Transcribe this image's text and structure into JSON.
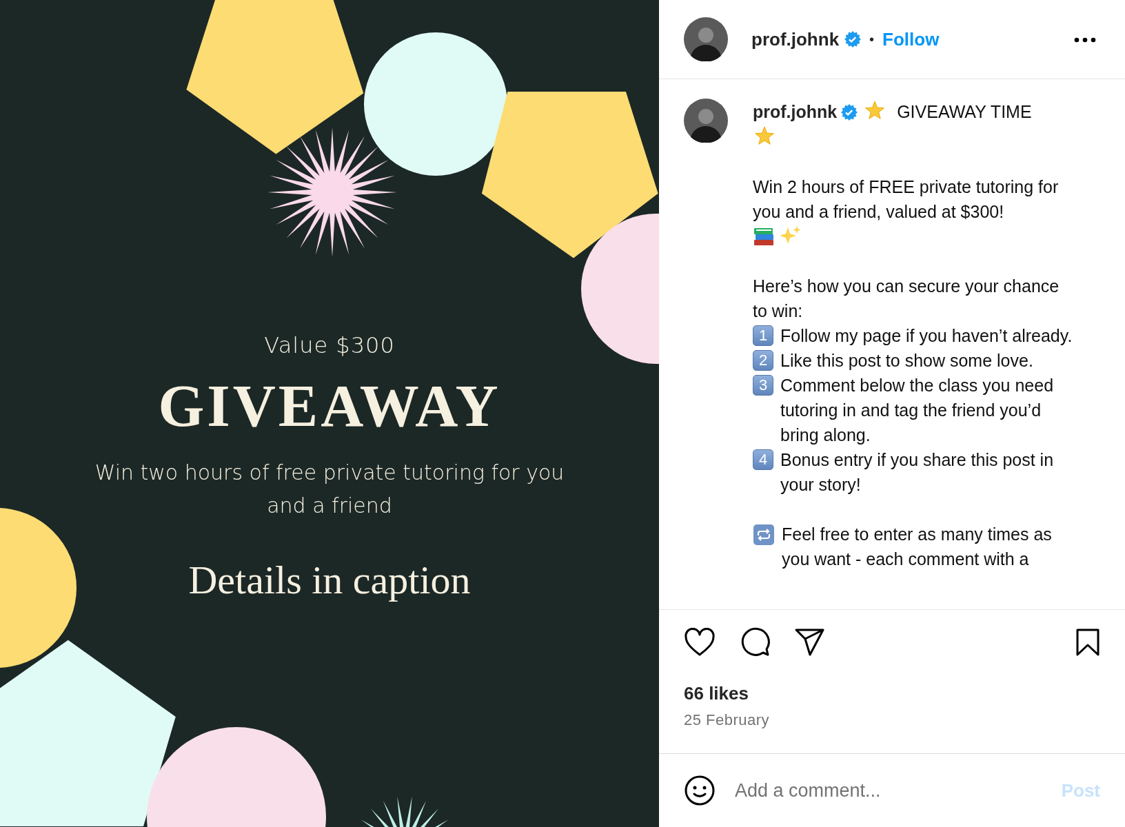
{
  "post_image": {
    "value": "Value $300",
    "title": "GIVEAWAY",
    "subtitle": "Win two hours of free private tutoring for you and a friend",
    "note": "Details in caption"
  },
  "header": {
    "username": "prof.johnk",
    "verified": true,
    "separator": "•",
    "follow": "Follow"
  },
  "caption": {
    "username": "prof.johnk",
    "verified": true,
    "title": "GIVEAWAY TIME",
    "sections": [
      [
        {
          "kind": "prize",
          "text": "Win 2 hours of FREE private tutoring for you and a friend, valued at $300!"
        }
      ],
      [
        {
          "kind": "paragraph",
          "text": "Here’s how you can secure your chance to win:"
        },
        {
          "kind": "step",
          "number": "1",
          "text": "Follow my page if you haven’t already."
        },
        {
          "kind": "step",
          "number": "2",
          "text": "Like this post to show some love."
        },
        {
          "kind": "step",
          "number": "3",
          "text": "Comment below the class you need tutoring in and tag the friend you’d bring along."
        },
        {
          "kind": "step",
          "number": "4",
          "text": "Bonus entry if you share this post in your story!"
        }
      ],
      [
        {
          "kind": "note",
          "text": "Feel free to enter as many times as you want - each comment with a"
        }
      ]
    ]
  },
  "likes": "66 likes",
  "date": "25 February",
  "comment_box": {
    "placeholder": "Add a comment...",
    "post_button": "Post",
    "disabled": true
  }
}
